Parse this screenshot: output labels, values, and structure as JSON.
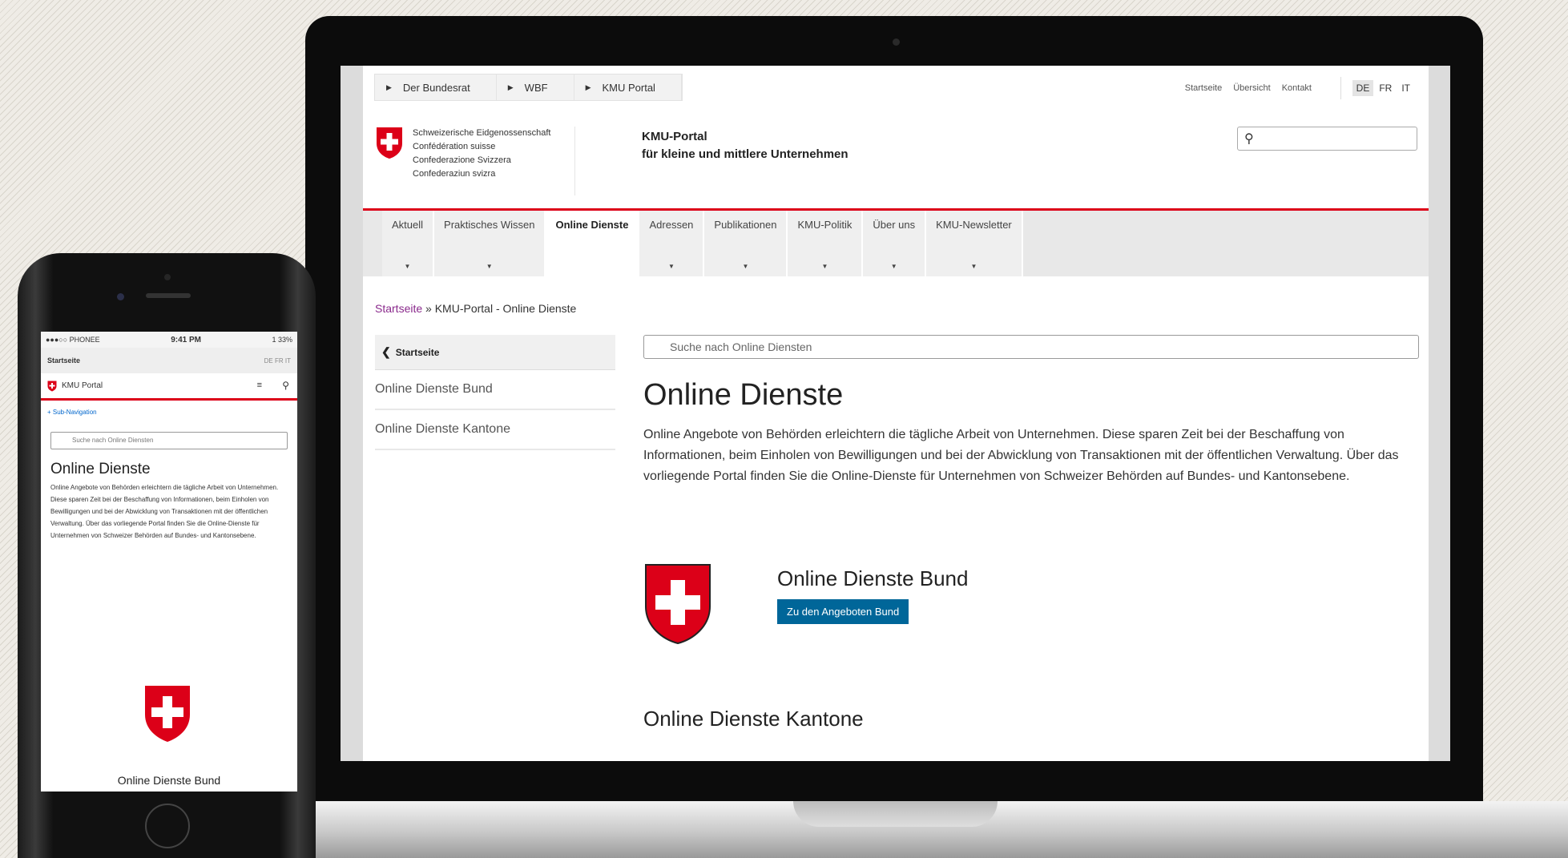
{
  "desktop": {
    "breadcrumbs": [
      "Der Bundesrat",
      "WBF",
      "KMU Portal"
    ],
    "top_links": [
      "Startseite",
      "Übersicht",
      "Kontakt"
    ],
    "languages": [
      "DE",
      "FR",
      "IT"
    ],
    "active_language": "DE",
    "confederation_names": [
      "Schweizerische Eidgenossenschaft",
      "Confédération suisse",
      "Confederazione Svizzera",
      "Confederaziun svizra"
    ],
    "portal_title": "KMU-Portal",
    "portal_subtitle": "für kleine und mittlere Unternehmen",
    "nav": [
      "Aktuell",
      "Praktisches Wissen",
      "Online Dienste",
      "Adressen",
      "Publikationen",
      "KMU-Politik",
      "Über uns",
      "KMU-Newsletter"
    ],
    "active_nav": "Online Dienste",
    "path_link": "Startseite",
    "path_current": "» KMU-Portal - Online Dienste",
    "sidebar": {
      "back_label": "Startseite",
      "items": [
        "Online Dienste Bund",
        "Online Dienste Kantone"
      ]
    },
    "search_placeholder": "Suche nach Online Diensten",
    "title": "Online Dienste",
    "intro": "Online Angebote von Behörden erleichtern die tägliche Arbeit von Unternehmen. Diese sparen Zeit bei der Beschaffung von Informationen, beim Einholen von Bewilligungen und bei der Abwicklung von Transaktionen mit der öffentlichen Verwaltung. Über das vorliegende Portal finden Sie die Online-Dienste für Unternehmen von Schweizer Behörden auf Bundes- und Kantonsebene.",
    "bund_title": "Online Dienste Bund",
    "bund_button": "Zu den Angeboten Bund",
    "kantone_title": "Online Dienste Kantone"
  },
  "mobile": {
    "carrier": "●●●○○ PHONEE",
    "time": "9:41 PM",
    "battery": "1 33%",
    "top_label": "Startseite",
    "languages": "DE FR IT",
    "portal": "KMU Portal",
    "subnav": "+ Sub-Navigation",
    "search_placeholder": "Suche nach Online Diensten",
    "title": "Online Dienste",
    "intro": "Online Angebote von Behörden erleichtern die tägliche Arbeit von Unternehmen. Diese sparen Zeit bei der Beschaffung von Informationen, beim Einholen von Bewilligungen und bei der Abwicklung von Transaktionen mit der öffentlichen Verwaltung. Über das vorliegende Portal finden Sie die Online-Dienste für Unternehmen von Schweizer Behörden auf Bundes- und Kantonsebene.",
    "bund_title": "Online Dienste Bund"
  },
  "colors": {
    "swiss_red": "#dc0018",
    "button_blue": "#006699",
    "link_purple": "#8a2a8c"
  }
}
